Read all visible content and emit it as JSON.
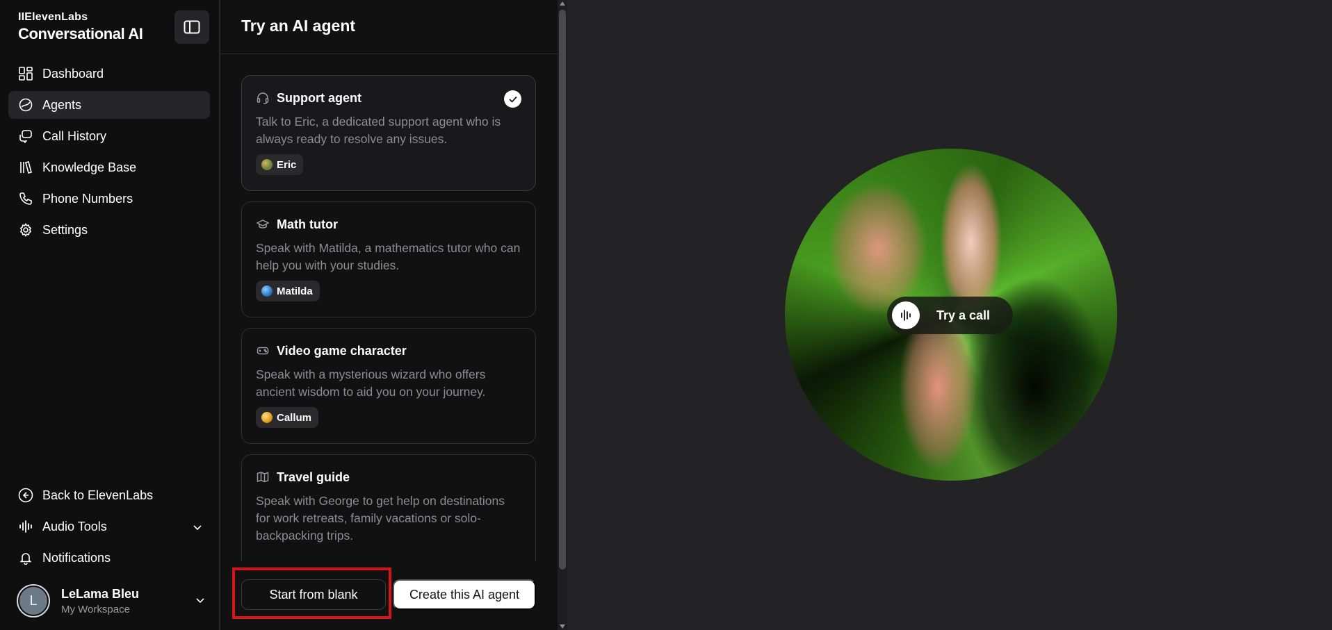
{
  "brand": {
    "company": "IIElevenLabs",
    "product": "Conversational AI"
  },
  "nav": {
    "items": [
      {
        "label": "Dashboard",
        "icon": "dashboard-icon"
      },
      {
        "label": "Agents",
        "icon": "agents-icon",
        "active": true
      },
      {
        "label": "Call History",
        "icon": "call-history-icon"
      },
      {
        "label": "Knowledge Base",
        "icon": "knowledge-base-icon"
      },
      {
        "label": "Phone Numbers",
        "icon": "phone-icon"
      },
      {
        "label": "Settings",
        "icon": "gear-icon"
      }
    ],
    "bottom": {
      "back": "Back to ElevenLabs",
      "audio_tools": "Audio Tools",
      "notifications": "Notifications"
    }
  },
  "user": {
    "initial": "L",
    "name": "LeLama Bleu",
    "workspace": "My Workspace"
  },
  "panel": {
    "title": "Try an AI agent",
    "cards": [
      {
        "title": "Support agent",
        "icon": "headset-icon",
        "desc": "Talk to Eric, a dedicated support agent who is always ready to resolve any issues.",
        "voice": "Eric",
        "voice_color": "#7c9a4a",
        "selected": true
      },
      {
        "title": "Math tutor",
        "icon": "graduation-cap-icon",
        "desc": "Speak with Matilda, a mathematics tutor who can help you with your studies.",
        "voice": "Matilda",
        "voice_color": "#3a8ad8"
      },
      {
        "title": "Video game character",
        "icon": "gamepad-icon",
        "desc": "Speak with a mysterious wizard who offers ancient wisdom to aid you on your journey.",
        "voice": "Callum",
        "voice_color": "#e0a020"
      },
      {
        "title": "Travel guide",
        "icon": "map-icon",
        "desc": "Speak with George to get help on destinations for work retreats, family vacations or solo-backpacking trips."
      }
    ],
    "start_blank": "Start from blank",
    "create_agent": "Create this AI agent"
  },
  "stage": {
    "try_call": "Try a call"
  },
  "colors": {
    "highlight": "#d4161c",
    "background": "#232325",
    "sidebar": "#0f0f10"
  }
}
